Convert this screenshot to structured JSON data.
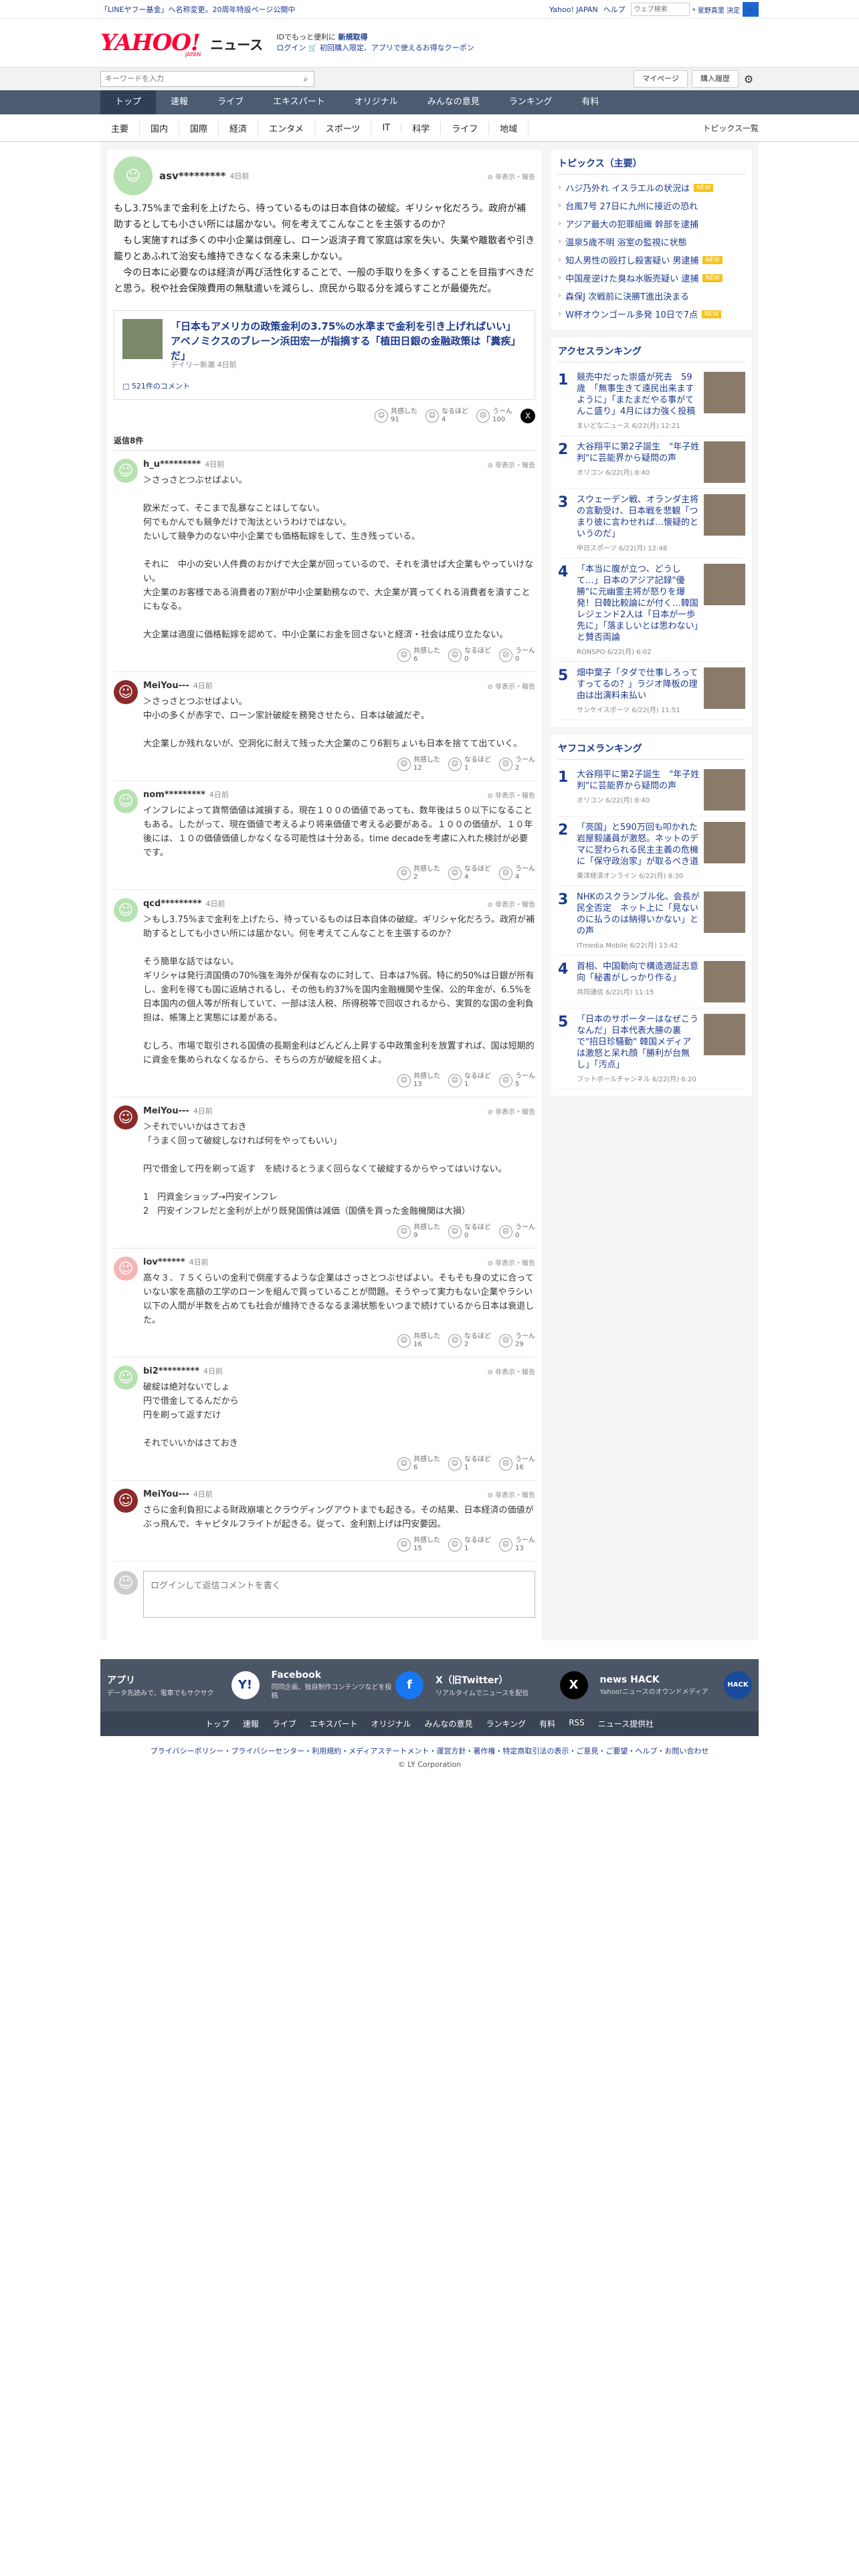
{
  "topstrip": {
    "announce": "「LINEヤフー基金」へ名称変更。20周年特設ページ公開中",
    "yahoo_japan": "Yahoo! JAPAN",
    "help": "ヘルプ",
    "search_placeholder": "ウェブ検索",
    "search_label": "* 星野真里 決定"
  },
  "header": {
    "logo_yahoo": "YAHOO!",
    "logo_japan": "JAPAN",
    "logo_news": "ニュース",
    "promo_line1_pre": "IDでもっと便利に",
    "promo_line1_link": "新規取得",
    "promo_line2": "ログイン 🛒 初回購入限定、アプリで使えるお得なクーポン"
  },
  "searchbar": {
    "placeholder": "キーワードを入力",
    "mypage": "マイページ",
    "history": "購入履歴"
  },
  "nav": [
    "トップ",
    "速報",
    "ライブ",
    "エキスパート",
    "オリジナル",
    "みんなの意見",
    "ランキング",
    "有料"
  ],
  "subnav": [
    "主要",
    "国内",
    "国際",
    "経済",
    "エンタメ",
    "スポーツ",
    "IT",
    "科学",
    "ライフ",
    "地域"
  ],
  "subnav_all": "トピックス一覧",
  "main_comment": {
    "user": "asv*********",
    "time": "4日前",
    "report": "非表示・報告",
    "text": "もし3.75%まで金利を上げたら、待っているものは日本自体の破綻。ギリシャ化だろう。政府が補助するとしても小さい所には届かない。何を考えてこんなことを主張するのか？\n　もし実施すれば多くの中小企業は倒産し、ローン返済子育て家庭は家を失い、失業や離散者や引き籠りとあふれて治安も維持できなくなる未来しかない。\n　今の日本に必要なのは経済が再び活性化することで、一般の手取りを多くすることを目指すべきだと思う。税や社会保険費用の無駄遣いを減らし、庶民から取る分を減らすことが最優先だ。",
    "article_title": "「日本もアメリカの政策金利の3.75%の水準まで金利を引き上げればいい」 アベノミクスのブレーン浜田宏一が指摘する「植田日銀の金融政策は「糞疾」だ」",
    "article_source": "デイリー新潮 4日前",
    "comment_count": "521件のコメント",
    "reacts": {
      "agree_label": "共感した",
      "agree": "91",
      "naruhodo_label": "なるほど",
      "naruhodo": "4",
      "uun_label": "うーん",
      "uun": "100"
    }
  },
  "replies_header": "返信8件",
  "replies": [
    {
      "user": "h_u*********",
      "time": "4日前",
      "report": "非表示・報告",
      "text": "＞さっさとつぶせばよい。\n\n欧米だって、そこまで乱暴なことはしてない。\n何でもかんでも競争だけで淘汰というわけではない。\nたいして競争力のない中小企業でも価格転嫁をして、生き残っている。\n\nそれに　中小の安い人件費のおかげで大企業が回っているので、それを潰せば大企業もやっていけない。\n大企業のお客様である消費者の7割が中小企業勤務なので、大企業が貰ってくれる消費者を潰すことにもなる。\n\n大企業は適度に価格転嫁を認めて、中小企業にお金を回さないと経済・社会は成り立たない。",
      "agree": "6",
      "naruhodo": "0",
      "uun": "0"
    },
    {
      "user": "MeiYou---",
      "time": "4日前",
      "report": "非表示・報告",
      "text": "＞さっさとつぶせばよい。\n中小の多くが赤字で、ローン家計破綻を務発させたら、日本は破滅だぞ。\n\n大企業しか残れないが、空洞化に耐えて残った大企業のこり6割ちょいも日本を捨てて出ていく。",
      "agree": "12",
      "naruhodo": "1",
      "uun": "2"
    },
    {
      "user": "nom*********",
      "time": "4日前",
      "report": "非表示・報告",
      "text": "インフレによって貨幣価値は減損する。現在１００の価値であっても、数年後は５０以下になることもある。したがって、現在価値で考えるより将来価値で考える必要がある。１００の価値が、１０年後には、１０の価値価値しかなくなる可能性は十分ある。time decadeを考慮に入れた検討が必要です。",
      "agree": "2",
      "naruhodo": "4",
      "uun": "4"
    },
    {
      "user": "qcd*********",
      "time": "4日前",
      "report": "非表示・報告",
      "text": "＞もし3.75%まで金利を上げたら、待っているものは日本自体の破綻。ギリシャ化だろう。政府が補助するとしても小さい所には届かない。何を考えてこんなことを主張するのか？\n\nそう簡単な話ではない。\nギリシャは発行済国債の70%強を海外が保有なのに対して、日本は7%弱。特に約50%は日銀が所有し、金利を得ても国に返納されるし、その他も約37%を国内金融機関や生保、公的年金が、6.5%を日本国内の個人等が所有していて、一部は法人税、所得税等で回収されるから、実質的な国の金利負担は、帳簿上と実態には差がある。\n\nむしろ、市場で取引される国債の長期金利はどんどん上昇する中政策金利を放置すれば、国は短期的に資金を集められなくなるから、そちらの方が破綻を招くよ。",
      "agree": "13",
      "naruhodo": "1",
      "uun": "5"
    },
    {
      "user": "MeiYou---",
      "time": "4日前",
      "report": "非表示・報告",
      "text": "＞それでいいかはさておき\n「うまく回って破綻しなければ何をやってもいい」\n\n円で借金して円を刷って返す　を続けるとうまく回らなくて破綻するからやってはいけない。\n\n1　円資金ショップ→円安インフレ\n2　円安インフレだと金利が上がり既発国債は減価（国債を買った金融機関は大損）",
      "agree": "9",
      "naruhodo": "0",
      "uun": "0"
    },
    {
      "user": "lov******",
      "time": "4日前",
      "report": "非表示・報告",
      "text": "高々３．７５くらいの金利で倒産するような企業はさっさとつぶせばよい。そもそも身の丈に合っていない家を高額の工学のローンを組んで買っていることが問題。そうやって実力もない企業やラシい以下の人間が半数を占めても社会が維持できるなるま湯状態をいつまで続けているから日本は衰退した。",
      "agree": "16",
      "naruhodo": "2",
      "uun": "29"
    },
    {
      "user": "bi2*********",
      "time": "4日前",
      "report": "非表示・報告",
      "text": "破綻は絶対ないでしょ\n円で借金してるんだから\n円を刷って返すだけ\n\nそれでいいかはさておき",
      "agree": "6",
      "naruhodo": "1",
      "uun": "16"
    },
    {
      "user": "MeiYou---",
      "time": "4日前",
      "report": "非表示・報告",
      "text": "さらに金利負担による財政崩壊とクラウディングアウトまでも起きる。その結果、日本経済の価値が ぶっ飛んで、キャピタルフライトが起きる。従って、金利割上げは円安要因。",
      "agree": "15",
      "naruhodo": "1",
      "uun": "13"
    }
  ],
  "reply_form_placeholder": "ログインして返信コメントを書く",
  "topics": {
    "title": "トピックス（主要）",
    "items": [
      {
        "text": "ハジ乃外れ イスラエルの状況は",
        "badge": "NEW"
      },
      {
        "text": "台風7号 27日に九州に接近の恐れ",
        "badge": ""
      },
      {
        "text": "アジア最大の犯罪組織 幹部を逮捕",
        "badge": ""
      },
      {
        "text": "温泉5歳不明 浴室の監視に状態",
        "badge": ""
      },
      {
        "text": "知人男性の殴打し殺害疑い 男逮捕",
        "badge": "NEW"
      },
      {
        "text": "中国産逆けた臭ね水販売疑い 逮捕",
        "badge": "NEW"
      },
      {
        "text": "森保J 次戦前に決勝T進出決まる",
        "badge": ""
      },
      {
        "text": "W杯オウンゴール多発 10日で7点",
        "badge": "NEW"
      }
    ]
  },
  "access_ranking": {
    "title": "アクセスランキング",
    "items": [
      {
        "num": "1",
        "title": "競売中だった崇盛が死去　59歳　「無事生きて遠民出来ますように」「またまだやる事がてんこ盛り」4月には力強く投稿",
        "meta": "まいどなニュース 6/22(月) 12:21"
      },
      {
        "num": "2",
        "title": "大谷翔平に第2子誕生　\"年子姓判\"に芸能界から疑問の声",
        "meta": "オリコン 6/22(月) 8:40"
      },
      {
        "num": "3",
        "title": "スウェーデン戦、オランダ主将の言動受け、日本戦を悲観「つまり彼に言わせれば…懐疑的というのだ」",
        "meta": "中日スポーツ 6/22(月) 12:48"
      },
      {
        "num": "4",
        "title": "「本当に腹が立つ、どうして…」日本のアジア記録\"優勝\"に元幽霊主将が怒りを爆発！日韓比較論にが付く…韓国レジェンド2人は「日本が一歩先に」「落ましいとは思わない」と賛否両論",
        "meta": "RONSPO 6/22(月) 6:02"
      },
      {
        "num": "5",
        "title": "畑中葉子「タダで仕事しろってすってるの？」ラジオ降板の理由は出演料未払い",
        "meta": "サンケイスポーツ 6/22(月) 11:51"
      }
    ]
  },
  "comment_ranking": {
    "title": "ヤフコメランキング",
    "items": [
      {
        "num": "1",
        "title": "大谷翔平に第2子誕生　\"年子姓判\"に芸能界から疑問の声",
        "meta": "オリコン 6/22(月) 8:40"
      },
      {
        "num": "2",
        "title": "「亮国」と590万回も叩かれた岩屋毅議員が激怒。ネットのデマに翌わられる民主主義の危機に「保守政治家」が取るべき道",
        "meta": "東洋経済オンライン 6/22(月) 8:30"
      },
      {
        "num": "3",
        "title": "NHKのスクランブル化、会長が民全否定　ネット上に「見ないのに払うのは納得いかない」との声",
        "meta": "ITmedia Mobile 6/22(月) 13:42"
      },
      {
        "num": "4",
        "title": "首相、中国動向で構造適証志意向「秘書がしっかり作る」",
        "meta": "共同通信 6/22(月) 11:15"
      },
      {
        "num": "5",
        "title": "「日本のサポーターはなぜこうなんだ」日本代表大勝の裏で\"招日珍騒動\" 韓国メディアは激怒と呆れ顔「勝利が台無し」「汚点」",
        "meta": "フットボールチャンネル 6/22(月) 6:20"
      }
    ]
  },
  "footer": {
    "apps": [
      {
        "name": "アプリ",
        "desc": "データ先読みで、電車でもサクサク",
        "icon": "Y!"
      },
      {
        "name": "Facebook",
        "desc": "同同企画、独自制作コンテンツなどを投稿",
        "icon": "f"
      },
      {
        "name": "X（旧Twitter）",
        "desc": "リアルタイムでニュースを配信",
        "icon": "X"
      },
      {
        "name": "news HACK",
        "desc": "Yahoo!ニュースのオウンドメディア",
        "icon": "HACK"
      }
    ],
    "links": [
      "トップ",
      "速報",
      "ライブ",
      "エキスパート",
      "オリジナル",
      "みんなの意見",
      "ランキング",
      "有料",
      "RSS",
      "ニュース提供社"
    ],
    "legal": "プライバシーポリシー・プライバシーセンター・利用規約・メディアステートメント・運営方針・著作権・特定商取引法の表示・ご意見・ご要望・ヘルプ・お問い合わせ",
    "copyright": "© LY Corporation"
  }
}
